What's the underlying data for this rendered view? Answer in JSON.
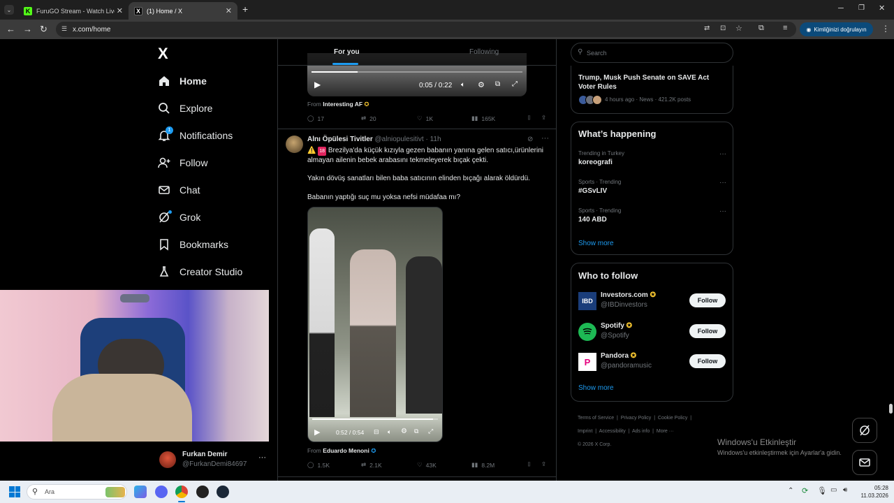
{
  "browser": {
    "tabs": [
      {
        "title": "FuruGO Stream - Watch Live on",
        "fav": "K"
      },
      {
        "title": "(1) Home / X",
        "fav": "X"
      }
    ],
    "url": "x.com/home",
    "verify_label": "Kimliğinizi doğrulayın",
    "new_tab": "+"
  },
  "sidebar": {
    "logo": "X",
    "items": [
      {
        "label": "Home",
        "icon": "home-icon"
      },
      {
        "label": "Explore",
        "icon": "search-icon"
      },
      {
        "label": "Notifications",
        "icon": "bell-icon",
        "badge": "1"
      },
      {
        "label": "Follow",
        "icon": "person-plus-icon"
      },
      {
        "label": "Chat",
        "icon": "mail-icon"
      },
      {
        "label": "Grok",
        "icon": "grok-icon"
      },
      {
        "label": "Bookmarks",
        "icon": "bookmark-icon"
      },
      {
        "label": "Creator Studio",
        "icon": "flask-icon"
      }
    ],
    "account_name": "Furkan Demir",
    "account_handle": "@FurkanDemi84697",
    "more": "···"
  },
  "feed": {
    "tab_for_you": "For you",
    "tab_following": "Following",
    "tweet1": {
      "video_time": "0:05 / 0:22",
      "from_label": "From",
      "from_name": "Interesting AF",
      "replies": "17",
      "reposts": "20",
      "likes": "1K",
      "views": "165K"
    },
    "tweet2": {
      "name": "Alnı Öpülesi Tivitler",
      "handle": "@alniopulesitivt",
      "time": "· 11h",
      "line1_prefix": "⚠️",
      "line1_badge": "18",
      "line1": "Brezilya'da küçük kızıyla gezen babanın yanına gelen satıcı,ürünlerini almayan ailenin bebek arabasını tekmeleyerek bıçak çekti.",
      "line2": "Yakın dövüş sanatları bilen baba satıcının elinden bıçağı alarak öldürdü.",
      "line3": "Babanın yaptığı suç mu yoksa nefsi müdafaa mı?",
      "video_time": "0:52 / 0:54",
      "from_label": "From",
      "from_name": "Eduardo Menoni",
      "replies": "1.5K",
      "reposts": "2.1K",
      "likes": "43K",
      "views": "8.2M"
    }
  },
  "right": {
    "search_placeholder": "Search",
    "news_title": "Trump, Musk Push Senate on SAVE Act Voter Rules",
    "news_meta": "4 hours ago · News · 421.2K posts",
    "happening_title": "What’s happening",
    "trends": [
      {
        "context": "Trending in Turkey",
        "name": "koreografi"
      },
      {
        "context": "Sports · Trending",
        "name": "#GSvLIV"
      },
      {
        "context": "Sports · Trending",
        "name": "140 ABD"
      }
    ],
    "show_more": "Show more",
    "wtf_title": "Who to follow",
    "follow": [
      {
        "name": "Investors.com",
        "handle": "@IBDinvestors",
        "avatar": "IBD",
        "color": "#1a3d7a"
      },
      {
        "name": "Spotify",
        "handle": "@Spotify",
        "avatar": "",
        "color": "#1db954"
      },
      {
        "name": "Pandora",
        "handle": "@pandoramusic",
        "avatar": "P",
        "color": "#ffffff"
      }
    ],
    "follow_label": "Follow",
    "footer": [
      "Terms of Service",
      "Privacy Policy",
      "Cookie Policy",
      "Imprint",
      "Accessibility",
      "Ads info",
      "More ···",
      "© 2026 X Corp."
    ]
  },
  "watermark": {
    "line1": "Windows'u Etkinleştir",
    "line2": "Windows'u etkinleştirmek için Ayarlar'a gidin."
  },
  "taskbar": {
    "search_label": "Ara",
    "time": "05:28",
    "date": "11.03.2026"
  }
}
